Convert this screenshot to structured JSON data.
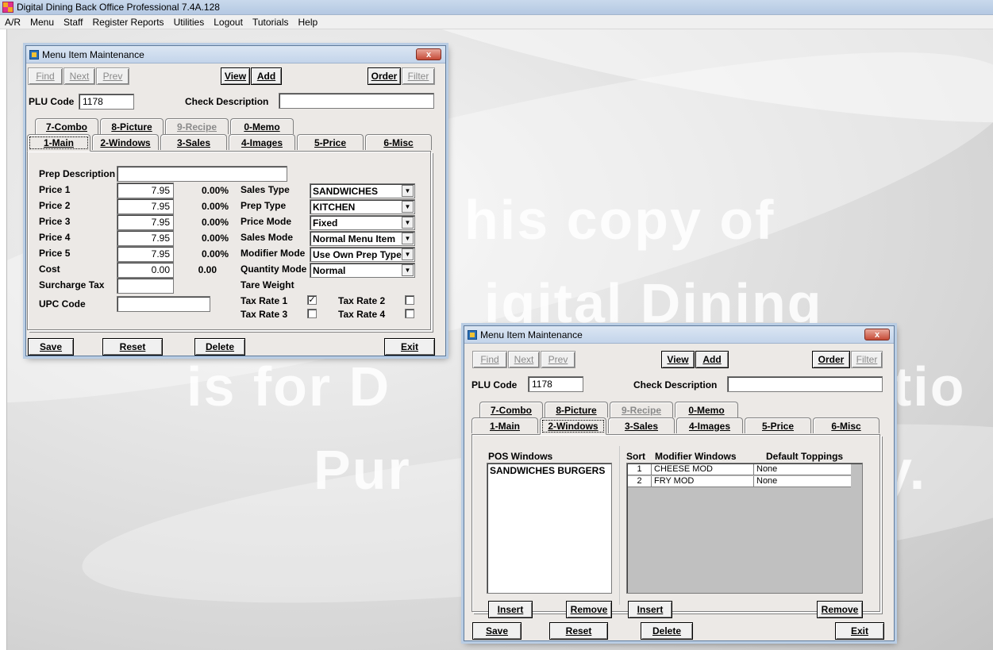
{
  "app": {
    "title": "Digital Dining Back Office  Professional  7.4A.128",
    "menu": [
      "A/R",
      "Menu",
      "Staff",
      "Register Reports",
      "Utilities",
      "Logout",
      "Tutorials",
      "Help"
    ]
  },
  "watermark": [
    "his copy of",
    "igital Dining",
    "is for D",
    "Pur",
    "y.",
    "tio"
  ],
  "toolbar": {
    "find": "Find",
    "next": "Next",
    "prev": "Prev",
    "view": "View",
    "add": "Add",
    "order": "Order",
    "filter": "Filter"
  },
  "header": {
    "plu_label": "PLU Code",
    "plu_value": "1178",
    "check_label": "Check Description",
    "check_value": ""
  },
  "tabs_row1": [
    "7-Combo",
    "8-Picture",
    "9-Recipe",
    "0-Memo"
  ],
  "tabs_row2": [
    "1-Main",
    "2-Windows",
    "3-Sales",
    "4-Images",
    "5-Price",
    "6-Misc"
  ],
  "footer": {
    "save": "Save",
    "reset": "Reset",
    "delete": "Delete",
    "exit": "Exit"
  },
  "window1": {
    "title": "Menu Item Maintenance",
    "close": "x",
    "prep_description_label": "Prep Description",
    "prep_description_value": "",
    "prices": [
      {
        "label": "Price 1",
        "value": "7.95",
        "pct": "0.00%"
      },
      {
        "label": "Price 2",
        "value": "7.95",
        "pct": "0.00%"
      },
      {
        "label": "Price 3",
        "value": "7.95",
        "pct": "0.00%"
      },
      {
        "label": "Price 4",
        "value": "7.95",
        "pct": "0.00%"
      },
      {
        "label": "Price 5",
        "value": "7.95",
        "pct": "0.00%"
      }
    ],
    "cost": {
      "label": "Cost",
      "value": "0.00",
      "extra": "0.00"
    },
    "surcharge_label": "Surcharge Tax",
    "upc_label": "UPC Code",
    "selects": [
      {
        "label": "Sales Type",
        "value": "SANDWICHES"
      },
      {
        "label": "Prep Type",
        "value": "KITCHEN"
      },
      {
        "label": "Price Mode",
        "value": "Fixed"
      },
      {
        "label": "Sales Mode",
        "value": "Normal Menu Item"
      },
      {
        "label": "Modifier Mode",
        "value": "Use Own Prep Type"
      },
      {
        "label": "Quantity Mode",
        "value": "Normal"
      }
    ],
    "tare_label": "Tare Weight",
    "tax": [
      {
        "label": "Tax Rate 1",
        "checked": "✓"
      },
      {
        "label": "Tax Rate 2",
        "checked": ""
      },
      {
        "label": "Tax Rate 3",
        "checked": ""
      },
      {
        "label": "Tax Rate 4",
        "checked": ""
      }
    ]
  },
  "window2": {
    "title": "Menu Item Maintenance",
    "close": "x",
    "pos_windows_label": "POS Windows",
    "pos_windows_items": [
      "SANDWICHES BURGERS"
    ],
    "sort_label": "Sort",
    "modifier_label": "Modifier Windows",
    "toppings_label": "Default Toppings",
    "modifier_rows": [
      {
        "sort": "1",
        "name": "CHEESE MOD",
        "topping": "None"
      },
      {
        "sort": "2",
        "name": "FRY MOD",
        "topping": "None"
      }
    ],
    "insert": "Insert",
    "remove": "Remove"
  }
}
